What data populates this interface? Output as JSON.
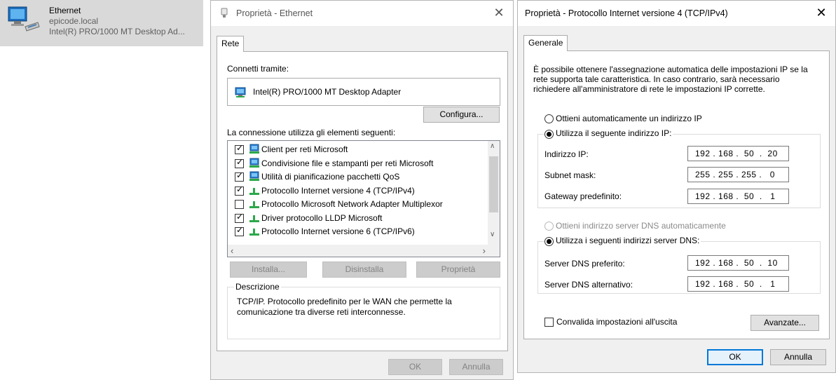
{
  "adapter_tile": {
    "name": "Ethernet",
    "domain": "epicode.local",
    "device": "Intel(R) PRO/1000 MT Desktop Ad..."
  },
  "dialog1": {
    "title": "Proprietà - Ethernet",
    "close": "✕",
    "tab": "Rete",
    "connect_label": "Connetti tramite:",
    "adapter": "Intel(R) PRO/1000 MT Desktop Adapter",
    "configure_button": "Configura...",
    "items_label": "La connessione utilizza gli elementi seguenti:",
    "items": [
      {
        "label": "Client per reti Microsoft",
        "checked": true,
        "icon": "network-client-icon"
      },
      {
        "label": "Condivisione file e stampanti per reti Microsoft",
        "checked": true,
        "icon": "network-client-icon"
      },
      {
        "label": "Utilità di pianificazione pacchetti QoS",
        "checked": true,
        "icon": "network-client-icon"
      },
      {
        "label": "Protocollo Internet versione 4 (TCP/IPv4)",
        "checked": true,
        "icon": "protocol-icon"
      },
      {
        "label": "Protocollo Microsoft Network Adapter Multiplexor",
        "checked": false,
        "icon": "protocol-icon"
      },
      {
        "label": "Driver protocollo LLDP Microsoft",
        "checked": true,
        "icon": "protocol-icon"
      },
      {
        "label": "Protocollo Internet versione 6 (TCP/IPv6)",
        "checked": true,
        "icon": "protocol-icon"
      }
    ],
    "install_button": "Installa...",
    "uninstall_button": "Disinstalla",
    "properties_button": "Proprietà",
    "description_title": "Descrizione",
    "description_text_1": "TCP/IP. Protocollo predefinito per le WAN che permette la",
    "description_text_2": "comunicazione tra diverse reti interconnesse.",
    "ok_button": "OK",
    "cancel_button": "Annulla"
  },
  "dialog2": {
    "title": "Proprietà - Protocollo Internet versione 4 (TCP/IPv4)",
    "close": "✕",
    "tab": "Generale",
    "intro_1": "È possibile ottenere l'assegnazione automatica delle impostazioni IP se la",
    "intro_2": "rete supporta tale caratteristica. In caso contrario, sarà necessario",
    "intro_3": "richiedere all'amministratore di rete le impostazioni IP corrette.",
    "ip_auto_label": "Ottieni automaticamente un indirizzo IP",
    "ip_manual_label": "Utilizza il seguente indirizzo IP:",
    "ip_address_label": "Indirizzo IP:",
    "ip_address_value": "192 . 168 .  50  .  20",
    "subnet_label": "Subnet mask:",
    "subnet_value": "255 . 255 . 255 .   0",
    "gateway_label": "Gateway predefinito:",
    "gateway_value": "192 . 168 .  50  .   1",
    "dns_auto_label": "Ottieni indirizzo server DNS automaticamente",
    "dns_manual_label": "Utilizza i seguenti indirizzi server DNS:",
    "dns_pref_label": "Server DNS preferito:",
    "dns_pref_value": "192 . 168 .  50  .  10",
    "dns_alt_label": "Server DNS alternativo:",
    "dns_alt_value": "192 . 168 .  50  .   1",
    "validate_label": "Convalida impostazioni all'uscita",
    "advanced_button": "Avanzate...",
    "ok_button": "OK",
    "cancel_button": "Annulla"
  }
}
